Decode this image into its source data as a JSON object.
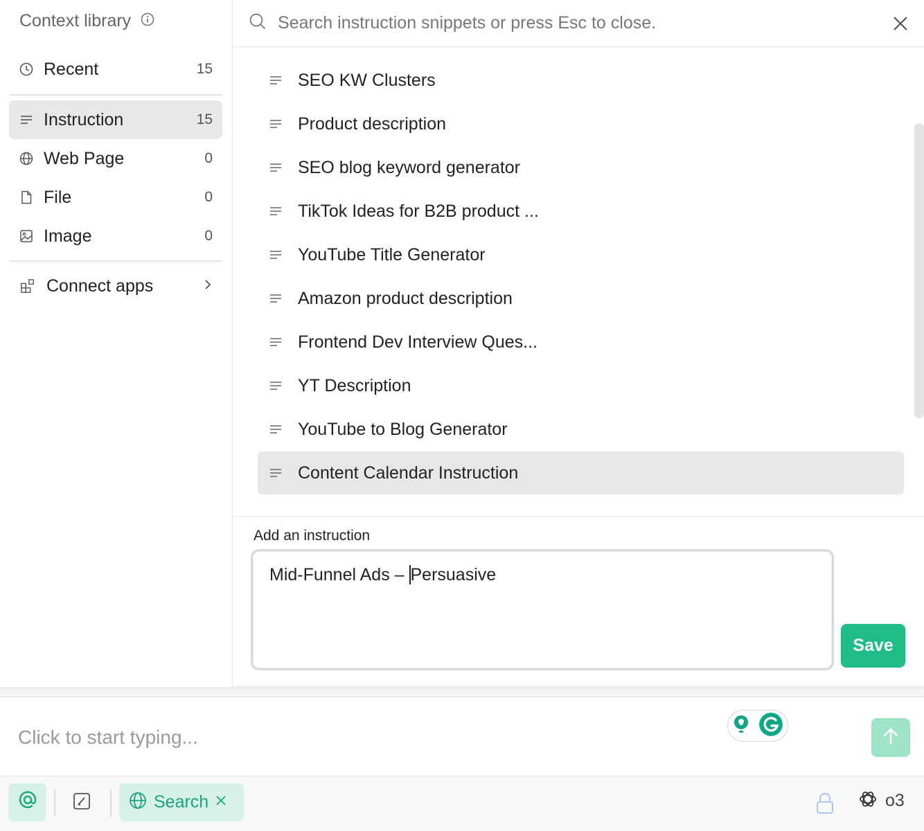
{
  "sidebar": {
    "title": "Context library",
    "items": [
      {
        "label": "Recent",
        "count": "15",
        "icon": "clock-icon"
      },
      {
        "label": "Instruction",
        "count": "15",
        "icon": "lines-icon"
      },
      {
        "label": "Web Page",
        "count": "0",
        "icon": "globe-icon"
      },
      {
        "label": "File",
        "count": "0",
        "icon": "file-icon"
      },
      {
        "label": "Image",
        "count": "0",
        "icon": "image-icon"
      }
    ],
    "connect_apps": "Connect apps"
  },
  "search": {
    "placeholder": "Search instruction snippets or press Esc to close."
  },
  "list": {
    "items": [
      "SEO KW Clusters",
      "Product description",
      "SEO blog keyword generator",
      "TikTok Ideas for B2B product ...",
      "YouTube Title Generator",
      "Amazon product description",
      "Frontend Dev Interview Ques...",
      "YT Description",
      "YouTube to Blog Generator",
      "Content Calendar Instruction"
    ],
    "selected_index": 9
  },
  "add_instruction": {
    "label": "Add an instruction",
    "value_before_caret": "Mid-Funnel Ads – ",
    "value_after_caret": "Persuasive",
    "save_label": "Save"
  },
  "composer": {
    "placeholder": "Click to start typing..."
  },
  "toolbar": {
    "search_label": "Search",
    "model_label": "o3"
  },
  "colors": {
    "accent": "#1ebd85",
    "accent_light": "#d8f1e6",
    "selected_bg": "#e8e8e8"
  }
}
